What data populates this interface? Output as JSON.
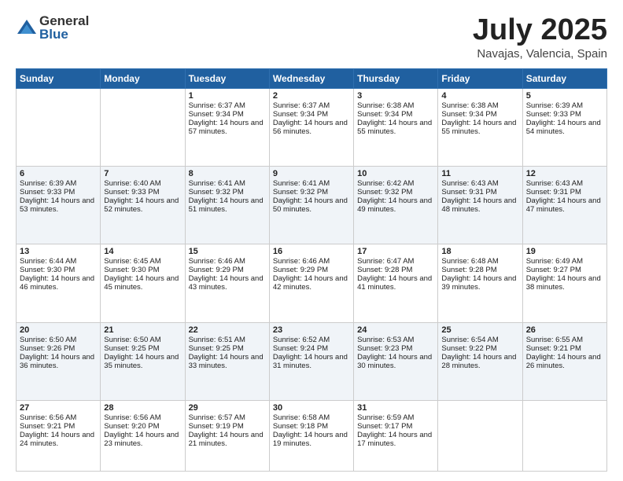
{
  "header": {
    "logo_general": "General",
    "logo_blue": "Blue",
    "month": "July 2025",
    "location": "Navajas, Valencia, Spain"
  },
  "days_of_week": [
    "Sunday",
    "Monday",
    "Tuesday",
    "Wednesday",
    "Thursday",
    "Friday",
    "Saturday"
  ],
  "weeks": [
    [
      {
        "day": "",
        "empty": true
      },
      {
        "day": "",
        "empty": true
      },
      {
        "day": "1",
        "sunrise": "Sunrise: 6:37 AM",
        "sunset": "Sunset: 9:34 PM",
        "daylight": "Daylight: 14 hours and 57 minutes."
      },
      {
        "day": "2",
        "sunrise": "Sunrise: 6:37 AM",
        "sunset": "Sunset: 9:34 PM",
        "daylight": "Daylight: 14 hours and 56 minutes."
      },
      {
        "day": "3",
        "sunrise": "Sunrise: 6:38 AM",
        "sunset": "Sunset: 9:34 PM",
        "daylight": "Daylight: 14 hours and 55 minutes."
      },
      {
        "day": "4",
        "sunrise": "Sunrise: 6:38 AM",
        "sunset": "Sunset: 9:34 PM",
        "daylight": "Daylight: 14 hours and 55 minutes."
      },
      {
        "day": "5",
        "sunrise": "Sunrise: 6:39 AM",
        "sunset": "Sunset: 9:33 PM",
        "daylight": "Daylight: 14 hours and 54 minutes."
      }
    ],
    [
      {
        "day": "6",
        "sunrise": "Sunrise: 6:39 AM",
        "sunset": "Sunset: 9:33 PM",
        "daylight": "Daylight: 14 hours and 53 minutes."
      },
      {
        "day": "7",
        "sunrise": "Sunrise: 6:40 AM",
        "sunset": "Sunset: 9:33 PM",
        "daylight": "Daylight: 14 hours and 52 minutes."
      },
      {
        "day": "8",
        "sunrise": "Sunrise: 6:41 AM",
        "sunset": "Sunset: 9:32 PM",
        "daylight": "Daylight: 14 hours and 51 minutes."
      },
      {
        "day": "9",
        "sunrise": "Sunrise: 6:41 AM",
        "sunset": "Sunset: 9:32 PM",
        "daylight": "Daylight: 14 hours and 50 minutes."
      },
      {
        "day": "10",
        "sunrise": "Sunrise: 6:42 AM",
        "sunset": "Sunset: 9:32 PM",
        "daylight": "Daylight: 14 hours and 49 minutes."
      },
      {
        "day": "11",
        "sunrise": "Sunrise: 6:43 AM",
        "sunset": "Sunset: 9:31 PM",
        "daylight": "Daylight: 14 hours and 48 minutes."
      },
      {
        "day": "12",
        "sunrise": "Sunrise: 6:43 AM",
        "sunset": "Sunset: 9:31 PM",
        "daylight": "Daylight: 14 hours and 47 minutes."
      }
    ],
    [
      {
        "day": "13",
        "sunrise": "Sunrise: 6:44 AM",
        "sunset": "Sunset: 9:30 PM",
        "daylight": "Daylight: 14 hours and 46 minutes."
      },
      {
        "day": "14",
        "sunrise": "Sunrise: 6:45 AM",
        "sunset": "Sunset: 9:30 PM",
        "daylight": "Daylight: 14 hours and 45 minutes."
      },
      {
        "day": "15",
        "sunrise": "Sunrise: 6:46 AM",
        "sunset": "Sunset: 9:29 PM",
        "daylight": "Daylight: 14 hours and 43 minutes."
      },
      {
        "day": "16",
        "sunrise": "Sunrise: 6:46 AM",
        "sunset": "Sunset: 9:29 PM",
        "daylight": "Daylight: 14 hours and 42 minutes."
      },
      {
        "day": "17",
        "sunrise": "Sunrise: 6:47 AM",
        "sunset": "Sunset: 9:28 PM",
        "daylight": "Daylight: 14 hours and 41 minutes."
      },
      {
        "day": "18",
        "sunrise": "Sunrise: 6:48 AM",
        "sunset": "Sunset: 9:28 PM",
        "daylight": "Daylight: 14 hours and 39 minutes."
      },
      {
        "day": "19",
        "sunrise": "Sunrise: 6:49 AM",
        "sunset": "Sunset: 9:27 PM",
        "daylight": "Daylight: 14 hours and 38 minutes."
      }
    ],
    [
      {
        "day": "20",
        "sunrise": "Sunrise: 6:50 AM",
        "sunset": "Sunset: 9:26 PM",
        "daylight": "Daylight: 14 hours and 36 minutes."
      },
      {
        "day": "21",
        "sunrise": "Sunrise: 6:50 AM",
        "sunset": "Sunset: 9:25 PM",
        "daylight": "Daylight: 14 hours and 35 minutes."
      },
      {
        "day": "22",
        "sunrise": "Sunrise: 6:51 AM",
        "sunset": "Sunset: 9:25 PM",
        "daylight": "Daylight: 14 hours and 33 minutes."
      },
      {
        "day": "23",
        "sunrise": "Sunrise: 6:52 AM",
        "sunset": "Sunset: 9:24 PM",
        "daylight": "Daylight: 14 hours and 31 minutes."
      },
      {
        "day": "24",
        "sunrise": "Sunrise: 6:53 AM",
        "sunset": "Sunset: 9:23 PM",
        "daylight": "Daylight: 14 hours and 30 minutes."
      },
      {
        "day": "25",
        "sunrise": "Sunrise: 6:54 AM",
        "sunset": "Sunset: 9:22 PM",
        "daylight": "Daylight: 14 hours and 28 minutes."
      },
      {
        "day": "26",
        "sunrise": "Sunrise: 6:55 AM",
        "sunset": "Sunset: 9:21 PM",
        "daylight": "Daylight: 14 hours and 26 minutes."
      }
    ],
    [
      {
        "day": "27",
        "sunrise": "Sunrise: 6:56 AM",
        "sunset": "Sunset: 9:21 PM",
        "daylight": "Daylight: 14 hours and 24 minutes."
      },
      {
        "day": "28",
        "sunrise": "Sunrise: 6:56 AM",
        "sunset": "Sunset: 9:20 PM",
        "daylight": "Daylight: 14 hours and 23 minutes."
      },
      {
        "day": "29",
        "sunrise": "Sunrise: 6:57 AM",
        "sunset": "Sunset: 9:19 PM",
        "daylight": "Daylight: 14 hours and 21 minutes."
      },
      {
        "day": "30",
        "sunrise": "Sunrise: 6:58 AM",
        "sunset": "Sunset: 9:18 PM",
        "daylight": "Daylight: 14 hours and 19 minutes."
      },
      {
        "day": "31",
        "sunrise": "Sunrise: 6:59 AM",
        "sunset": "Sunset: 9:17 PM",
        "daylight": "Daylight: 14 hours and 17 minutes."
      },
      {
        "day": "",
        "empty": true
      },
      {
        "day": "",
        "empty": true
      }
    ]
  ]
}
